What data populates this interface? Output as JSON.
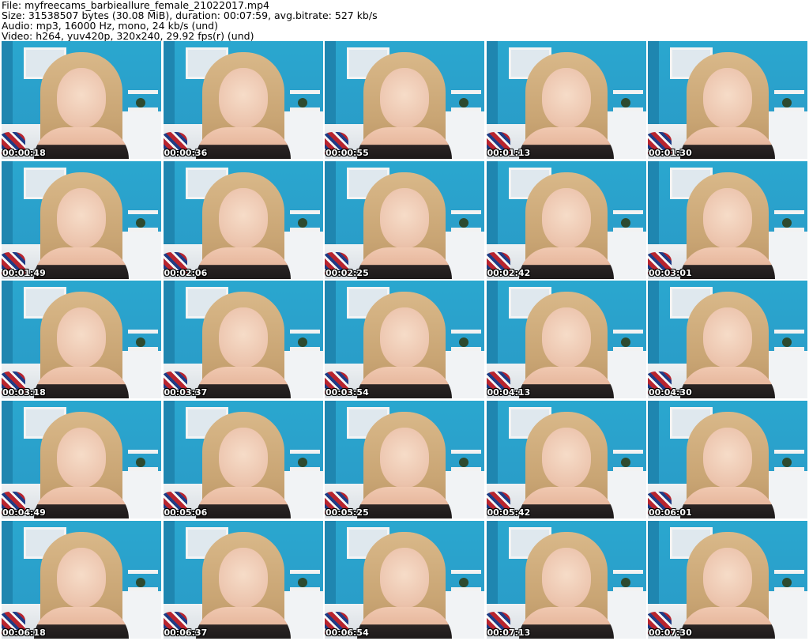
{
  "header": {
    "file": "File: myfreecams_barbieallure_female_21022017.mp4",
    "size": "Size: 31538507 bytes (30.08 MiB), duration: 00:07:59, avg.bitrate: 527 kb/s",
    "audio": "Audio: mp3, 16000 Hz, mono, 24 kb/s (und)",
    "video": "Video: h264, yuv420p, 320x240, 29.92 fps(r) (und)"
  },
  "thumbnails": [
    {
      "timestamp": "00:00:18"
    },
    {
      "timestamp": "00:00:36"
    },
    {
      "timestamp": "00:00:55"
    },
    {
      "timestamp": "00:01:13"
    },
    {
      "timestamp": "00:01:30"
    },
    {
      "timestamp": "00:01:49"
    },
    {
      "timestamp": "00:02:06"
    },
    {
      "timestamp": "00:02:25"
    },
    {
      "timestamp": "00:02:42"
    },
    {
      "timestamp": "00:03:01"
    },
    {
      "timestamp": "00:03:18"
    },
    {
      "timestamp": "00:03:37"
    },
    {
      "timestamp": "00:03:54"
    },
    {
      "timestamp": "00:04:13"
    },
    {
      "timestamp": "00:04:30"
    },
    {
      "timestamp": "00:04:49"
    },
    {
      "timestamp": "00:05:06"
    },
    {
      "timestamp": "00:05:25"
    },
    {
      "timestamp": "00:05:42"
    },
    {
      "timestamp": "00:06:01"
    },
    {
      "timestamp": "00:06:18"
    },
    {
      "timestamp": "00:06:37"
    },
    {
      "timestamp": "00:06:54"
    },
    {
      "timestamp": "00:07:13"
    },
    {
      "timestamp": "00:07:30"
    }
  ]
}
